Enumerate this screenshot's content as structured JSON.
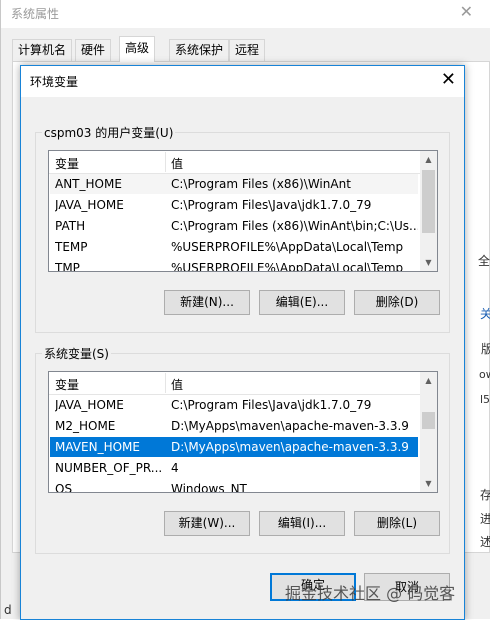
{
  "background_window": {
    "title": "系统属性",
    "close_glyph": "✕",
    "tabs": [
      "计算机名",
      "硬件",
      "高级",
      "系统保护",
      "远程"
    ],
    "active_tab_index": 2,
    "edge_fragments": [
      "全",
      "关",
      "版",
      "ow",
      "l5",
      "存",
      "进",
      "述",
      "d"
    ]
  },
  "dialog": {
    "title": "环境变量",
    "close_glyph": "✕",
    "user_vars": {
      "label": "cspm03 的用户变量(U)",
      "col_var": "变量",
      "col_val": "值",
      "rows": [
        {
          "name": "ANT_HOME",
          "value": "C:\\Program Files (x86)\\WinAnt"
        },
        {
          "name": "JAVA_HOME",
          "value": "C:\\Program Files\\Java\\jdk1.7.0_79"
        },
        {
          "name": "PATH",
          "value": "C:\\Program Files (x86)\\WinAnt\\bin;C:\\Us..."
        },
        {
          "name": "TEMP",
          "value": "%USERPROFILE%\\AppData\\Local\\Temp"
        },
        {
          "name": "TMP",
          "value": "%USERPROFILE%\\AppData\\Local\\Temp"
        }
      ],
      "buttons": {
        "new": "新建(N)...",
        "edit": "编辑(E)...",
        "delete": "删除(D)"
      }
    },
    "system_vars": {
      "label": "系统变量(S)",
      "col_var": "变量",
      "col_val": "值",
      "rows": [
        {
          "name": "JAVA_HOME",
          "value": "C:\\Program Files\\Java\\jdk1.7.0_79"
        },
        {
          "name": "M2_HOME",
          "value": "D:\\MyApps\\maven\\apache-maven-3.3.9"
        },
        {
          "name": "MAVEN_HOME",
          "value": "D:\\MyApps\\maven\\apache-maven-3.3.9"
        },
        {
          "name": "NUMBER_OF_PR...",
          "value": "4"
        },
        {
          "name": "OS",
          "value": "Windows_NT"
        }
      ],
      "selected_index": 2,
      "buttons": {
        "new": "新建(W)...",
        "edit": "编辑(I)...",
        "delete": "删除(L)"
      }
    },
    "ok": "确定",
    "cancel": "取消"
  },
  "watermark": "掘金技术社区 @ 码觉客",
  "colors": {
    "accent": "#0078d7",
    "selection": "#0078d7",
    "dialog_border": "#1883d7"
  },
  "icons": {
    "close": "close-icon",
    "scroll_up": "chevron-up-icon",
    "scroll_down": "chevron-down-icon"
  }
}
